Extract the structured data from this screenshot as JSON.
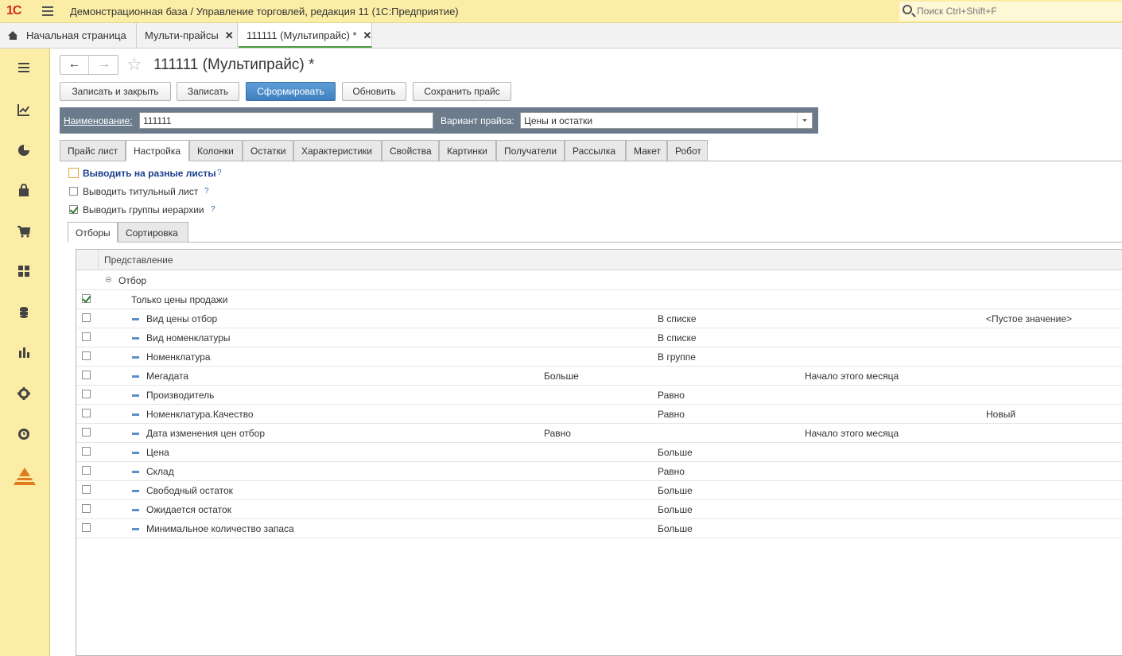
{
  "app": {
    "logo": "1С",
    "title": "Демонстрационная база / Управление торговлей, редакция 11  (1С:Предприятие)",
    "search_placeholder": "Поиск Ctrl+Shift+F"
  },
  "window_tabs": [
    {
      "label": "Начальная страница",
      "closable": false
    },
    {
      "label": "Мульти-прайсы",
      "closable": true
    },
    {
      "label": "111111 (Мультипрайс) *",
      "closable": true,
      "active": true
    }
  ],
  "sidebar": {
    "icons": [
      "menu-icon",
      "chart-up-icon",
      "pie-icon",
      "bag-icon",
      "cart-icon",
      "grid-icon",
      "coins-icon",
      "bar-chart-icon",
      "gear-icon",
      "history-icon",
      "pyramid-icon"
    ]
  },
  "form": {
    "title": "111111 (Мультипрайс) *",
    "buttons": {
      "save_close": "Записать и закрыть",
      "save": "Записать",
      "generate": "Сформировать",
      "refresh": "Обновить",
      "save_price": "Сохранить прайс"
    },
    "name_label": "Наименование:",
    "name_value": "111111",
    "variant_label": "Вариант прайса:",
    "variant_value": "Цены и остатки",
    "tabs": [
      "Прайс лист",
      "Настройка",
      "Колонки",
      "Остатки",
      "Характеристики",
      "Свойства",
      "Картинки",
      "Получатели",
      "Рассылка",
      "Макет",
      "Робот"
    ],
    "active_tab": "Настройка",
    "options": [
      {
        "label": "Выводить на разные листы",
        "checked": false,
        "help": "?"
      },
      {
        "label": "Выводить титульный лист",
        "checked": false,
        "help": "?"
      },
      {
        "label": "Выводить группы иерархии",
        "checked": true,
        "help": "?"
      }
    ],
    "subtabs": [
      "Отборы",
      "Сортировка"
    ],
    "table": {
      "header": "Представление",
      "group_label": "Отбор",
      "rows": [
        {
          "name": "Только цены продажи",
          "checked": true,
          "c1": "",
          "c2": "",
          "c3": "",
          "c4": "",
          "child": false
        },
        {
          "name": "Вид цены отбор",
          "checked": false,
          "c1": "",
          "c2": "В списке",
          "c3": "",
          "c4": "<Пустое значение>",
          "child": true
        },
        {
          "name": "Вид номенклатуры",
          "checked": false,
          "c1": "",
          "c2": "В списке",
          "c3": "",
          "c4": "",
          "child": true
        },
        {
          "name": "Номенклатура",
          "checked": false,
          "c1": "",
          "c2": "В группе",
          "c3": "",
          "c4": "",
          "child": true
        },
        {
          "name": "Мегадата",
          "checked": false,
          "c1": "Больше",
          "c2": "",
          "c3": "Начало этого месяца",
          "c4": "",
          "child": true
        },
        {
          "name": "Производитель",
          "checked": false,
          "c1": "",
          "c2": "Равно",
          "c3": "",
          "c4": "",
          "child": true
        },
        {
          "name": "Номенклатура.Качество",
          "checked": false,
          "c1": "",
          "c2": "Равно",
          "c3": "",
          "c4": "Новый",
          "child": true
        },
        {
          "name": "Дата изменения цен отбор",
          "checked": false,
          "c1": "Равно",
          "c2": "",
          "c3": "Начало этого месяца",
          "c4": "",
          "child": true
        },
        {
          "name": "Цена",
          "checked": false,
          "c1": "",
          "c2": "Больше",
          "c3": "",
          "c4": "",
          "child": true
        },
        {
          "name": "Склад",
          "checked": false,
          "c1": "",
          "c2": "Равно",
          "c3": "",
          "c4": "",
          "child": true
        },
        {
          "name": "Свободный остаток",
          "checked": false,
          "c1": "",
          "c2": "Больше",
          "c3": "",
          "c4": "",
          "child": true
        },
        {
          "name": "Ожидается остаток",
          "checked": false,
          "c1": "",
          "c2": "Больше",
          "c3": "",
          "c4": "",
          "child": true
        },
        {
          "name": "Минимальное количество запаса",
          "checked": false,
          "c1": "",
          "c2": "Больше",
          "c3": "",
          "c4": "",
          "child": true
        }
      ]
    }
  }
}
